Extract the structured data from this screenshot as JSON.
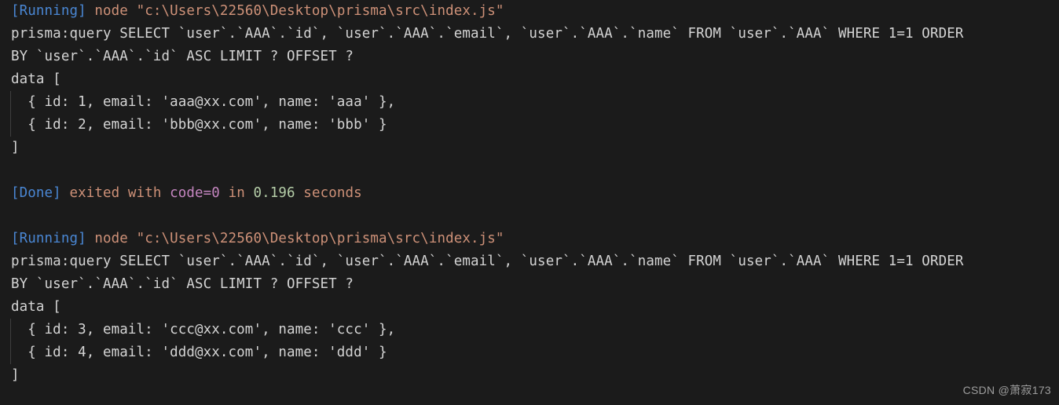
{
  "terminal": {
    "background_color": "#1b1b1b",
    "default_text_color": "#d4d4d4",
    "colors": {
      "status_tag": "#4a87d4",
      "string_path": "#ce9178",
      "message": "#ce9178",
      "code_token": "#c586c0",
      "number": "#b5cea8",
      "indent_guide": "#3f3f3f",
      "watermark": "#9d9d9d"
    },
    "lines": [
      {
        "id": "run-1-header",
        "indented": false,
        "tokens": [
          {
            "text": "[Running]",
            "style": "running"
          },
          {
            "text": " ",
            "style": "plain"
          },
          {
            "text": "node ",
            "style": "msg"
          },
          {
            "text": "\"c:\\Users\\22560\\Desktop\\prisma\\src\\index.js\"",
            "style": "path"
          }
        ]
      },
      {
        "id": "run-1-query-a",
        "indented": false,
        "tokens": [
          {
            "text": "prisma:query SELECT `user`.`AAA`.`id`, `user`.`AAA`.`email`, `user`.`AAA`.`name` FROM `user`.`AAA` WHERE 1=1 ORDER",
            "style": "plain"
          }
        ]
      },
      {
        "id": "run-1-query-b",
        "indented": false,
        "tokens": [
          {
            "text": "BY `user`.`AAA`.`id` ASC LIMIT ? OFFSET ?",
            "style": "plain"
          }
        ]
      },
      {
        "id": "run-1-data-open",
        "indented": false,
        "tokens": [
          {
            "text": "data [",
            "style": "plain"
          }
        ]
      },
      {
        "id": "run-1-row-1",
        "indented": true,
        "tokens": [
          {
            "text": "  { id: 1, email: 'aaa@xx.com', name: 'aaa' },",
            "style": "plain"
          }
        ]
      },
      {
        "id": "run-1-row-2",
        "indented": true,
        "tokens": [
          {
            "text": "  { id: 2, email: 'bbb@xx.com', name: 'bbb' }",
            "style": "plain"
          }
        ]
      },
      {
        "id": "run-1-data-close",
        "indented": false,
        "tokens": [
          {
            "text": "]",
            "style": "plain"
          }
        ]
      },
      {
        "id": "spacer-1",
        "indented": false,
        "tokens": [
          {
            "text": " ",
            "style": "plain"
          }
        ]
      },
      {
        "id": "done-1",
        "indented": false,
        "tokens": [
          {
            "text": "[Done]",
            "style": "done"
          },
          {
            "text": " ",
            "style": "plain"
          },
          {
            "text": "exited with ",
            "style": "msg"
          },
          {
            "text": "code=0",
            "style": "code"
          },
          {
            "text": " in ",
            "style": "msg"
          },
          {
            "text": "0.196",
            "style": "num"
          },
          {
            "text": " seconds",
            "style": "msg"
          }
        ]
      },
      {
        "id": "spacer-2",
        "indented": false,
        "tokens": [
          {
            "text": " ",
            "style": "plain"
          }
        ]
      },
      {
        "id": "run-2-header",
        "indented": false,
        "tokens": [
          {
            "text": "[Running]",
            "style": "running"
          },
          {
            "text": " ",
            "style": "plain"
          },
          {
            "text": "node ",
            "style": "msg"
          },
          {
            "text": "\"c:\\Users\\22560\\Desktop\\prisma\\src\\index.js\"",
            "style": "path"
          }
        ]
      },
      {
        "id": "run-2-query-a",
        "indented": false,
        "tokens": [
          {
            "text": "prisma:query SELECT `user`.`AAA`.`id`, `user`.`AAA`.`email`, `user`.`AAA`.`name` FROM `user`.`AAA` WHERE 1=1 ORDER",
            "style": "plain"
          }
        ]
      },
      {
        "id": "run-2-query-b",
        "indented": false,
        "tokens": [
          {
            "text": "BY `user`.`AAA`.`id` ASC LIMIT ? OFFSET ?",
            "style": "plain"
          }
        ]
      },
      {
        "id": "run-2-data-open",
        "indented": false,
        "tokens": [
          {
            "text": "data [",
            "style": "plain"
          }
        ]
      },
      {
        "id": "run-2-row-1",
        "indented": true,
        "tokens": [
          {
            "text": "  { id: 3, email: 'ccc@xx.com', name: 'ccc' },",
            "style": "plain"
          }
        ]
      },
      {
        "id": "run-2-row-2",
        "indented": true,
        "tokens": [
          {
            "text": "  { id: 4, email: 'ddd@xx.com', name: 'ddd' }",
            "style": "plain"
          }
        ]
      },
      {
        "id": "run-2-data-close",
        "indented": false,
        "tokens": [
          {
            "text": "]",
            "style": "plain"
          }
        ]
      }
    ]
  },
  "watermark": {
    "text": "CSDN @萧寂173"
  }
}
